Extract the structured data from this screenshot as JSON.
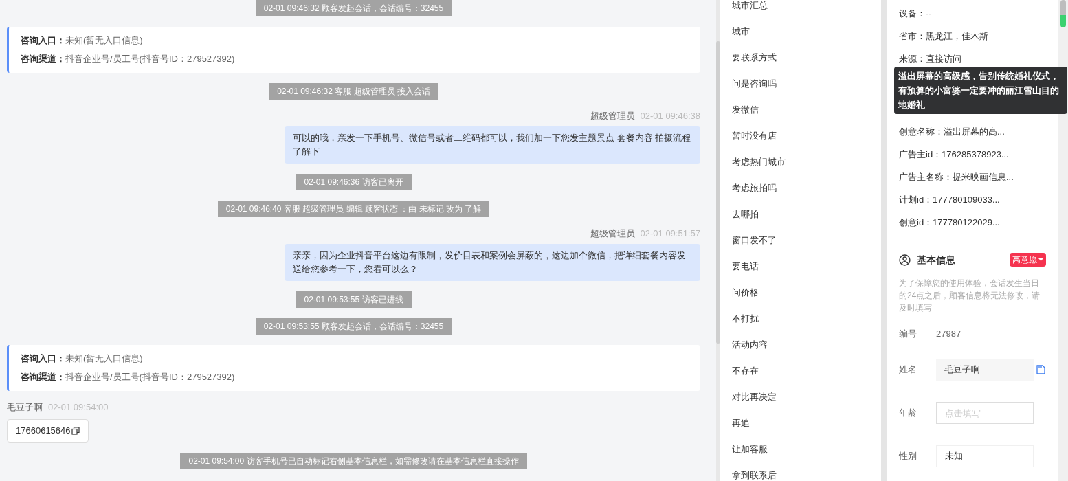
{
  "chat": {
    "messages": [
      {
        "kind": "system",
        "text": "02-01 09:46:32 顾客发起会话，会话编号：32455"
      },
      {
        "kind": "info",
        "rows": [
          {
            "label": "咨询入口：",
            "value": "未知(暂无入口信息)"
          },
          {
            "label": "咨询渠道：",
            "value": "抖音企业号/员工号(抖音号ID：279527392)"
          }
        ]
      },
      {
        "kind": "system",
        "text": "02-01 09:46:32 客服 超级管理员 接入会话"
      },
      {
        "kind": "agent",
        "name": "超级管理员",
        "time": "02-01 09:46:38",
        "text": "可以的哦，亲发一下手机号、微信号或者二维码都可以，我们加一下您发主题景点 套餐内容 拍摄流程了解下"
      },
      {
        "kind": "system",
        "text": "02-01 09:46:36 访客已离开"
      },
      {
        "kind": "system",
        "text": "02-01 09:46:40 客服 超级管理员 编辑 顾客状态 ：由 未标记 改为 了解"
      },
      {
        "kind": "agent",
        "name": "超级管理员",
        "time": "02-01 09:51:57",
        "text": "亲亲，因为企业抖音平台这边有限制，发价目表和案例会屏蔽的，这边加个微信，把详细套餐内容发送给您参考一下，您看可以么？"
      },
      {
        "kind": "system",
        "text": "02-01 09:53:55 访客已进线"
      },
      {
        "kind": "system",
        "text": "02-01 09:53:55 顾客发起会话，会话编号：32455"
      },
      {
        "kind": "info",
        "rows": [
          {
            "label": "咨询入口：",
            "value": "未知(暂无入口信息)"
          },
          {
            "label": "咨询渠道：",
            "value": "抖音企业号/员工号(抖音号ID：279527392)"
          }
        ]
      },
      {
        "kind": "visitor",
        "name": "毛豆子啊",
        "time": "02-01 09:54:00",
        "text": "17660615646"
      },
      {
        "kind": "system",
        "text": "02-01 09:54:00 访客手机号已自动标记右侧基本信息栏，如需修改请在基本信息栏直接操作"
      }
    ]
  },
  "tags": [
    "城市汇总",
    "城市",
    "要联系方式",
    "问是咨询吗",
    "发微信",
    "暂时没有店",
    "考虑热门城市",
    "考虑旅拍吗",
    "去哪拍",
    "窗口发不了",
    "要电话",
    "问价格",
    "不打扰",
    "活动内容",
    "不存在",
    "对比再决定",
    "再追",
    "让加客服",
    "拿到联系后"
  ],
  "details": {
    "rows_above": [
      "设备：--",
      "省市：黑龙江，佳木斯",
      "来源：直接访问"
    ],
    "rows_below": [
      "创意名称：溢出屏幕的高...",
      "广告主id：176285378923...",
      "广告主名称：提米映画信息...",
      "计划id：177780109033...",
      "创意id：177780122029..."
    ],
    "tooltip": "溢出屏幕的高级感，告别传统婚礼仪式，有预算的小富婆一定要冲的丽江雪山目的地婚礼",
    "section": {
      "title": "基本信息",
      "intent": "高意愿",
      "note": "为了保障您的使用体验，会话发生当日的24点之后，顾客信息将无法修改，请及时填写",
      "fields": [
        {
          "kind": "text",
          "label": "编号",
          "value": "27987"
        },
        {
          "kind": "filled",
          "label": "姓名",
          "value": "毛豆子啊",
          "copy": true
        },
        {
          "kind": "input",
          "label": "年龄",
          "placeholder": "点击填写"
        },
        {
          "kind": "plain",
          "label": "性别",
          "value": "未知"
        }
      ]
    }
  }
}
